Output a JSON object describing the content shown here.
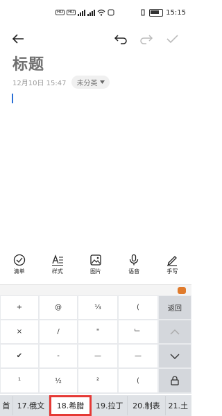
{
  "status": {
    "left_badges": [
      "HD",
      "HD"
    ],
    "signals": [
      "4G",
      "4G"
    ],
    "time": "15:15"
  },
  "toolbar": {
    "back_icon": "back-arrow-icon",
    "undo_icon": "undo-icon",
    "redo_icon": "redo-icon",
    "confirm_icon": "check-icon"
  },
  "note": {
    "title_placeholder": "标题",
    "date": "12月10日 15:47",
    "category": "未分类"
  },
  "tools": [
    {
      "icon": "checklist-icon",
      "label": "清单"
    },
    {
      "icon": "text-style-icon",
      "label": "样式"
    },
    {
      "icon": "image-icon",
      "label": "图片"
    },
    {
      "icon": "microphone-icon",
      "label": "语音"
    },
    {
      "icon": "handwriting-icon",
      "label": "手写"
    }
  ],
  "keyboard": {
    "rows": [
      [
        "+",
        "@",
        "⅓",
        "("
      ],
      [
        "×",
        "/",
        "\"",
        "﹂"
      ],
      [
        "✔",
        "-",
        "—",
        "—"
      ],
      [
        "¹",
        "½",
        "²",
        "("
      ]
    ],
    "side": {
      "return": "返回",
      "up_icon": "chevron-up-icon",
      "down_icon": "chevron-down-icon",
      "lock_icon": "lock-icon"
    }
  },
  "symbol_categories": [
    "首",
    "17.俄文",
    "18.希腊",
    "19.拉丁",
    "20.制表",
    "21.土"
  ],
  "selected_category": "18.希腊"
}
